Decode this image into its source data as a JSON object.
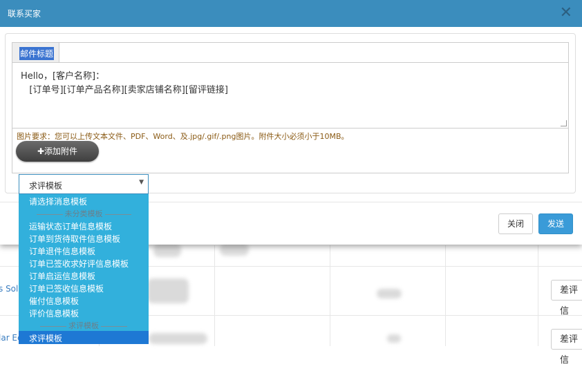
{
  "modal": {
    "title": "联系买家",
    "subject_label": "邮件标题",
    "subject_value": "",
    "body_text": "Hello，[客户名称]：\n   [订单号][订单产品名称][卖家店铺名称][留评链接]",
    "hint": "图片要求：您可以上传文本文件、PDF、Word、及.jpg/.gif/.png图片。附件大小必须小于10MB。",
    "attach_label": "✚添加附件",
    "close_label": "关闭",
    "send_label": "发送"
  },
  "template_select": {
    "selected": "求评模板",
    "options": [
      {
        "type": "option",
        "label": "请选择消息模板"
      },
      {
        "type": "group",
        "label": "未分类模板"
      },
      {
        "type": "option",
        "label": "运输状态订单信息模板"
      },
      {
        "type": "option",
        "label": "订单到货待取件信息模板"
      },
      {
        "type": "option",
        "label": "订单退件信息模板"
      },
      {
        "type": "option",
        "label": "订单已签收求好评信息模板"
      },
      {
        "type": "option",
        "label": "订单启运信息模板"
      },
      {
        "type": "option",
        "label": "订单已签收信息模板"
      },
      {
        "type": "option",
        "label": "催付信息模板"
      },
      {
        "type": "option",
        "label": "评价信息模板"
      },
      {
        "type": "group",
        "label": "求评模板"
      },
      {
        "type": "option",
        "label": "求评模板"
      }
    ]
  },
  "background": {
    "row_links": [
      "s Sola",
      "lar Ec"
    ],
    "row_buttons": [
      "差评信",
      "差评信"
    ]
  },
  "colors": {
    "header": "#3b8dbd",
    "dropdown": "#32b0dc",
    "selected": "#1e78d4",
    "send_button": "#3a9bd8"
  }
}
